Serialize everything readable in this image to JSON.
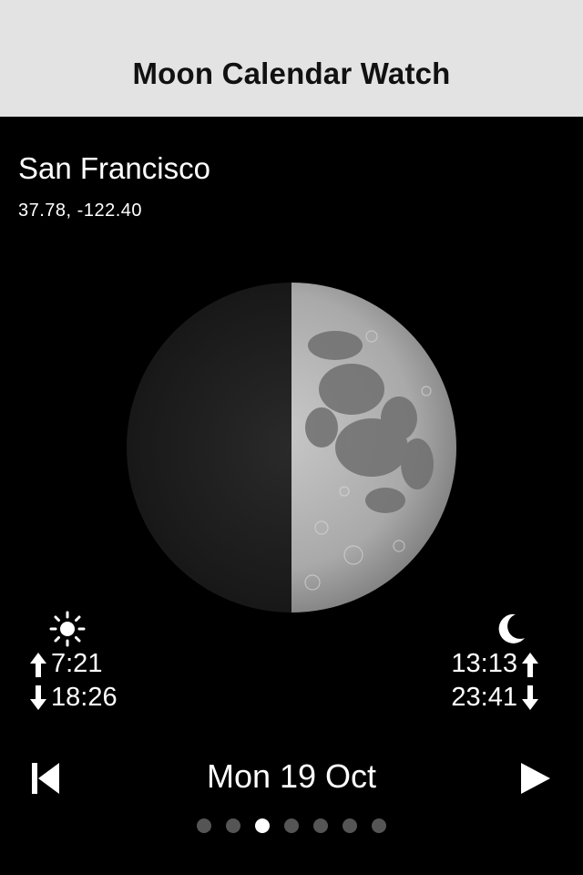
{
  "navbar": {
    "title": "Moon Calendar Watch"
  },
  "location": {
    "city": "San Francisco",
    "coords": "37.78, -122.40"
  },
  "moon": {
    "phase_icon": "first-quarter-moon-image",
    "illumination": 0.5
  },
  "sun": {
    "icon": "sun-icon",
    "rise": "7:21",
    "set": "18:26"
  },
  "moon_times": {
    "icon": "crescent-moon-icon",
    "rise": "13:13",
    "set": "23:41"
  },
  "date_nav": {
    "date": "Mon 19 Oct",
    "prev_icon": "skip-back-icon",
    "next_icon": "play-forward-icon"
  },
  "page_dots": {
    "count": 7,
    "active_index": 2
  }
}
